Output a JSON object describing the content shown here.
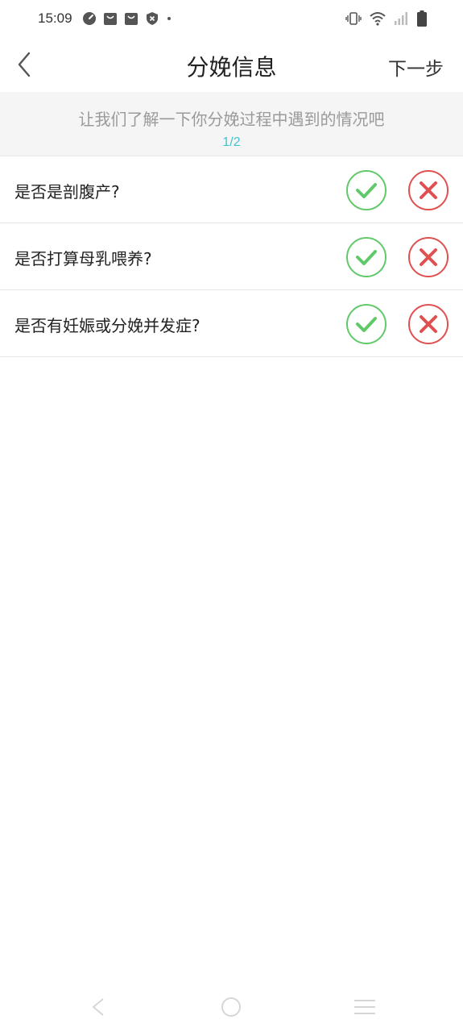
{
  "status_bar": {
    "time": "15:09",
    "left_icons": [
      "speedometer-icon",
      "shopping-bag-icon",
      "shopping-bag-icon",
      "shield-icon",
      "dot-icon"
    ],
    "right_icons": [
      "vibrate-icon",
      "wifi-icon",
      "cell-signal-icon",
      "battery-icon"
    ]
  },
  "header": {
    "title": "分娩信息",
    "next_label": "下一步",
    "back_icon": "chevron-left-icon"
  },
  "intro": {
    "text": "让我们了解一下你分娩过程中遇到的情况吧",
    "progress": "1/2"
  },
  "questions": [
    {
      "label": "是否是剖腹产?"
    },
    {
      "label": "是否打算母乳喂养?"
    },
    {
      "label": "是否有妊娠或分娩并发症?"
    }
  ],
  "colors": {
    "accent": "#3fc4d0",
    "yes": "#62c96b",
    "no": "#e05050",
    "intro_bg": "#f5f5f5"
  },
  "system_nav": [
    "back-triangle-icon",
    "home-circle-icon",
    "menu-lines-icon"
  ]
}
